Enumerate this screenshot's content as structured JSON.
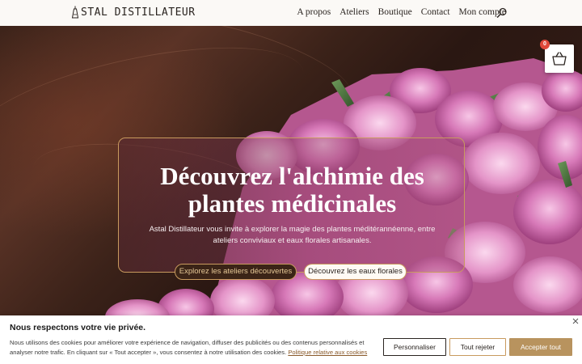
{
  "header": {
    "logo_text": "STAL DISTILLATEUR",
    "nav": [
      {
        "label": "A propos"
      },
      {
        "label": "Ateliers"
      },
      {
        "label": "Boutique"
      },
      {
        "label": "Contact"
      },
      {
        "label": "Mon compte"
      }
    ],
    "search_icon": "search-icon"
  },
  "cart": {
    "count": "0",
    "icon": "basket-icon"
  },
  "hero": {
    "title": "Découvrez l'alchimie des plantes médicinales",
    "subtitle": "Astal Distillateur vous invite à explorer la magie des plantes méditérannéenne, entre ateliers conviviaux et eaux florales artisanales.",
    "primary_button": "Explorez les ateliers découvertes",
    "secondary_button": "Découvrez les eaux florales"
  },
  "cookie_banner": {
    "title": "Nous respectons votre vie privée.",
    "text": "Nous utilisons des cookies pour améliorer votre expérience de navigation, diffuser des publicités ou des contenus personnalisés et analyser notre trafic. En cliquant sur « Tout accepter », vous consentez à notre utilisation des cookies.",
    "policy_link": "Politique relative aux cookies",
    "customize_button": "Personnaliser",
    "reject_button": "Tout rejeter",
    "accept_button": "Accepter tout"
  },
  "colors": {
    "accent_gold": "#c89a5e",
    "accept_button": "#b8935e",
    "badge_red": "#e0483a",
    "dark_brown": "#3b2417"
  }
}
